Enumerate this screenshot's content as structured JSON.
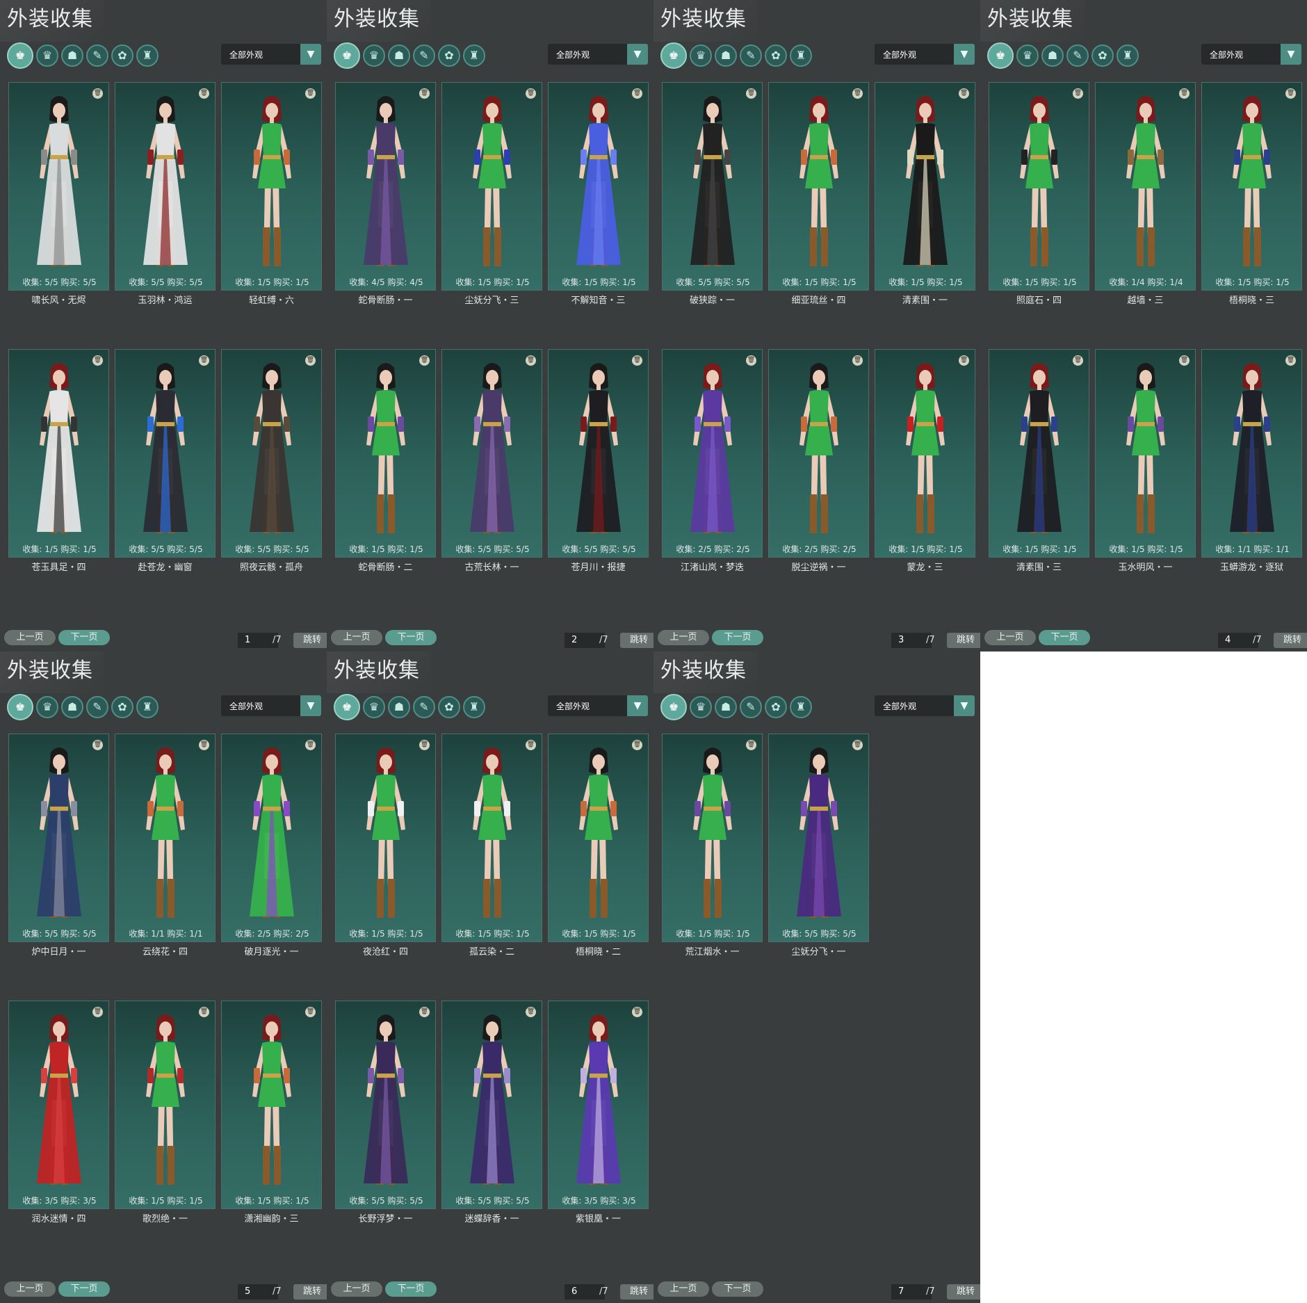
{
  "panels": [
    {
      "title": "外装收集",
      "tabs": [
        "♚",
        "♛",
        "☗",
        "✎",
        "✿",
        "♜"
      ],
      "filter": "全部外观",
      "page": "1",
      "total": "/7",
      "prev": "上一页",
      "next": "下一页",
      "jump": "跳转",
      "cards": [
        {
          "collect": "收集: 5/5",
          "buy": "购买: 5/5",
          "name": "啸长风・无烬",
          "outfit": "white",
          "hair": "#1a1a1a",
          "skirt": "#d9dcdc",
          "acc": "#8a8c8c"
        },
        {
          "collect": "收集: 5/5",
          "buy": "购买: 5/5",
          "name": "玉羽林・鸿运",
          "outfit": "white",
          "hair": "#1a1a1a",
          "skirt": "#e2e2e2",
          "acc": "#8a2020"
        },
        {
          "collect": "收集: 1/5",
          "buy": "购买: 1/5",
          "name": "轻虹缚・六",
          "outfit": "green",
          "hair": "#7a1a1a",
          "skirt": "#36b04c",
          "acc": "#c96a3a"
        },
        {
          "collect": "收集: 1/5",
          "buy": "购买: 1/5",
          "name": "苍玉具足・四",
          "outfit": "white",
          "hair": "#7a1a1a",
          "skirt": "#e5e5e5",
          "acc": "#333"
        },
        {
          "collect": "收集: 5/5",
          "buy": "购买: 5/5",
          "name": "赴苍龙・幽窗",
          "outfit": "dark",
          "hair": "#1a1a1a",
          "skirt": "#2b2b33",
          "acc": "#2d6bd6"
        },
        {
          "collect": "收集: 5/5",
          "buy": "购买: 5/5",
          "name": "照夜云骸・孤舟",
          "outfit": "dark",
          "hair": "#1a1a1a",
          "skirt": "#3a3532",
          "acc": "#5a4a3a"
        }
      ]
    },
    {
      "title": "外装收集",
      "tabs": [
        "♚",
        "♛",
        "☗",
        "✎",
        "✿",
        "♜"
      ],
      "filter": "全部外观",
      "page": "2",
      "total": "/7",
      "prev": "上一页",
      "next": "下一页",
      "jump": "跳转",
      "cards": [
        {
          "collect": "收集: 4/5",
          "buy": "购买: 4/5",
          "name": "蛇骨断肠・一",
          "outfit": "dark",
          "hair": "#1a1a1a",
          "skirt": "#4a3a6a",
          "acc": "#7a5aa6"
        },
        {
          "collect": "收集: 1/5",
          "buy": "购买: 1/5",
          "name": "尘妩分飞・三",
          "outfit": "green",
          "hair": "#7a1a1a",
          "skirt": "#36b04c",
          "acc": "#2b3fb0"
        },
        {
          "collect": "收集: 1/5",
          "buy": "购买: 1/5",
          "name": "不解知音・三",
          "outfit": "blue",
          "hair": "#7a1a1a",
          "skirt": "#4a5ee0",
          "acc": "#6a7ef0"
        },
        {
          "collect": "收集: 1/5",
          "buy": "购买: 1/5",
          "name": "蛇骨断肠・二",
          "outfit": "green",
          "hair": "#1a1a1a",
          "skirt": "#36b04c",
          "acc": "#6a4aa0"
        },
        {
          "collect": "收集: 5/5",
          "buy": "购买: 5/5",
          "name": "古荒长林・一",
          "outfit": "purple",
          "hair": "#1a1a1a",
          "skirt": "#4a3a6a",
          "acc": "#8a6ab0"
        },
        {
          "collect": "收集: 5/5",
          "buy": "购买: 5/5",
          "name": "苍月川・报捷",
          "outfit": "dark",
          "hair": "#1a1a1a",
          "skirt": "#1e1e22",
          "acc": "#7a1a1a"
        }
      ]
    },
    {
      "title": "外装收集",
      "tabs": [
        "♚",
        "♛",
        "☗",
        "✎",
        "✿",
        "♜"
      ],
      "filter": "全部外观",
      "page": "3",
      "total": "/7",
      "prev": "上一页",
      "next": "下一页",
      "jump": "跳转",
      "cards": [
        {
          "collect": "收集: 5/5",
          "buy": "购买: 5/5",
          "name": "破狭踪・一",
          "outfit": "dark",
          "hair": "#1a1a1a",
          "skirt": "#222",
          "acc": "#444"
        },
        {
          "collect": "收集: 1/5",
          "buy": "购买: 1/5",
          "name": "细亚琉丝・四",
          "outfit": "green",
          "hair": "#7a1a1a",
          "skirt": "#36b04c",
          "acc": "#c96a3a"
        },
        {
          "collect": "收集: 1/5",
          "buy": "购买: 1/5",
          "name": "清素围・一",
          "outfit": "dark",
          "hair": "#7a1a1a",
          "skirt": "#1a1a1a",
          "acc": "#e0d8c0"
        },
        {
          "collect": "收集: 2/5",
          "buy": "购买: 2/5",
          "name": "江渚山岚・梦迭",
          "outfit": "purple",
          "hair": "#7a1a1a",
          "skirt": "#5a3aa0",
          "acc": "#7a5ac8"
        },
        {
          "collect": "收集: 2/5",
          "buy": "购买: 2/5",
          "name": "脱尘逆祸・一",
          "outfit": "green",
          "hair": "#1a1a1a",
          "skirt": "#36b04c",
          "acc": "#c96a3a"
        },
        {
          "collect": "收集: 1/5",
          "buy": "购买: 1/5",
          "name": "蒙龙・三",
          "outfit": "green",
          "hair": "#7a1a1a",
          "skirt": "#36b04c",
          "acc": "#c82020"
        }
      ]
    },
    {
      "title": "外装收集",
      "tabs": [
        "♚",
        "♛",
        "☗",
        "✎",
        "✿",
        "♜"
      ],
      "filter": "全部外观",
      "page": "4",
      "total": "/7",
      "prev": "上一页",
      "next": "下一页",
      "jump": "跳转",
      "cards": [
        {
          "collect": "收集: 1/5",
          "buy": "购买: 1/5",
          "name": "照庭石・四",
          "outfit": "green",
          "hair": "#7a1a1a",
          "skirt": "#36b04c",
          "acc": "#222"
        },
        {
          "collect": "收集: 1/4",
          "buy": "购买: 1/4",
          "name": "越墙・三",
          "outfit": "green",
          "hair": "#7a1a1a",
          "skirt": "#36b04c",
          "acc": "#8a6a3a"
        },
        {
          "collect": "收集: 1/5",
          "buy": "购买: 1/5",
          "name": "梧桐晓・三",
          "outfit": "green",
          "hair": "#7a1a1a",
          "skirt": "#36b04c",
          "acc": "#2b3f8a"
        },
        {
          "collect": "收集: 1/5",
          "buy": "购买: 1/5",
          "name": "清素围・三",
          "outfit": "dark",
          "hair": "#7a1a1a",
          "skirt": "#1e1e22",
          "acc": "#2b3f8a"
        },
        {
          "collect": "收集: 1/5",
          "buy": "购买: 1/5",
          "name": "玉水明风・一",
          "outfit": "green",
          "hair": "#1a1a1a",
          "skirt": "#36b04c",
          "acc": "#6a4aa0"
        },
        {
          "collect": "收集: 1/1",
          "buy": "购买: 1/1",
          "name": "玉蟒游龙・逐狱",
          "outfit": "dark",
          "hair": "#7a1a1a",
          "skirt": "#1e2028",
          "acc": "#2b3f8a"
        }
      ]
    },
    {
      "title": "外装收集",
      "tabs": [
        "♚",
        "♛",
        "☗",
        "✎",
        "✿",
        "♜"
      ],
      "filter": "全部外观",
      "page": "5",
      "total": "/7",
      "prev": "上一页",
      "next": "下一页",
      "jump": "跳转",
      "cards": [
        {
          "collect": "收集: 5/5",
          "buy": "购买: 5/5",
          "name": "炉中日月・一",
          "outfit": "dark",
          "hair": "#1a1a1a",
          "skirt": "#2b3f6a",
          "acc": "#8a8ca0"
        },
        {
          "collect": "收集: 1/1",
          "buy": "购买: 1/1",
          "name": "云绕花・四",
          "outfit": "green",
          "hair": "#7a1a1a",
          "skirt": "#36b04c",
          "acc": "#c96a3a"
        },
        {
          "collect": "收集: 2/5",
          "buy": "购买: 2/5",
          "name": "破月逐光・一",
          "outfit": "purple",
          "hair": "#7a1a1a",
          "skirt": "#36b04c",
          "acc": "#8a4ac8"
        },
        {
          "collect": "收集: 3/5",
          "buy": "购买: 3/5",
          "name": "润水迷情・四",
          "outfit": "red",
          "hair": "#7a1a1a",
          "skirt": "#c02424",
          "acc": "#d84040"
        },
        {
          "collect": "收集: 1/5",
          "buy": "购买: 1/5",
          "name": "歌烈绝・一",
          "outfit": "green",
          "hair": "#7a1a1a",
          "skirt": "#36b04c",
          "acc": "#b02a2a"
        },
        {
          "collect": "收集: 1/5",
          "buy": "购买: 1/5",
          "name": "潇湘幽韵・三",
          "outfit": "green",
          "hair": "#7a1a1a",
          "skirt": "#36b04c",
          "acc": "#c96a3a"
        }
      ]
    },
    {
      "title": "外装收集",
      "tabs": [
        "♚",
        "♛",
        "☗",
        "✎",
        "✿",
        "♜"
      ],
      "filter": "全部外观",
      "page": "6",
      "total": "/7",
      "prev": "上一页",
      "next": "下一页",
      "jump": "跳转",
      "cards": [
        {
          "collect": "收集: 1/5",
          "buy": "购买: 1/5",
          "name": "夜沧红・四",
          "outfit": "green",
          "hair": "#7a1a1a",
          "skirt": "#36b04c",
          "acc": "#f0f0f0"
        },
        {
          "collect": "收集: 1/5",
          "buy": "购买: 1/5",
          "name": "孤云染・二",
          "outfit": "green",
          "hair": "#7a1a1a",
          "skirt": "#36b04c",
          "acc": "#f0f0f0"
        },
        {
          "collect": "收集: 1/5",
          "buy": "购买: 1/5",
          "name": "梧桐晓・二",
          "outfit": "green",
          "hair": "#1a1a1a",
          "skirt": "#36b04c",
          "acc": "#c96a3a"
        },
        {
          "collect": "收集: 5/5",
          "buy": "购买: 5/5",
          "name": "长野浮梦・一",
          "outfit": "purple",
          "hair": "#1a1a1a",
          "skirt": "#3a2a5a",
          "acc": "#7a5aa6"
        },
        {
          "collect": "收集: 5/5",
          "buy": "购买: 5/5",
          "name": "迷蝶辞香・一",
          "outfit": "purple",
          "hair": "#1a1a1a",
          "skirt": "#3a2a6a",
          "acc": "#9a8ad0"
        },
        {
          "collect": "收集: 3/5",
          "buy": "购买: 3/5",
          "name": "紫银凰・一",
          "outfit": "purple",
          "hair": "#7a1a1a",
          "skirt": "#5a3ab0",
          "acc": "#c0b0e0"
        }
      ]
    },
    {
      "title": "外装收集",
      "tabs": [
        "♚",
        "♛",
        "☗",
        "✎",
        "✿",
        "♜"
      ],
      "filter": "全部外观",
      "page": "7",
      "total": "/7",
      "prev": "上一页",
      "next": "下一页",
      "jump": "跳转",
      "cards": [
        {
          "collect": "收集: 1/5",
          "buy": "购买: 1/5",
          "name": "荒江烟水・一",
          "outfit": "green",
          "hair": "#1a1a1a",
          "skirt": "#36b04c",
          "acc": "#6a4aa0"
        },
        {
          "collect": "收集: 5/5",
          "buy": "购买: 5/5",
          "name": "尘妩分飞・一",
          "outfit": "purple",
          "hair": "#1a1a1a",
          "skirt": "#4a2a80",
          "acc": "#7a4ab0"
        }
      ]
    }
  ]
}
